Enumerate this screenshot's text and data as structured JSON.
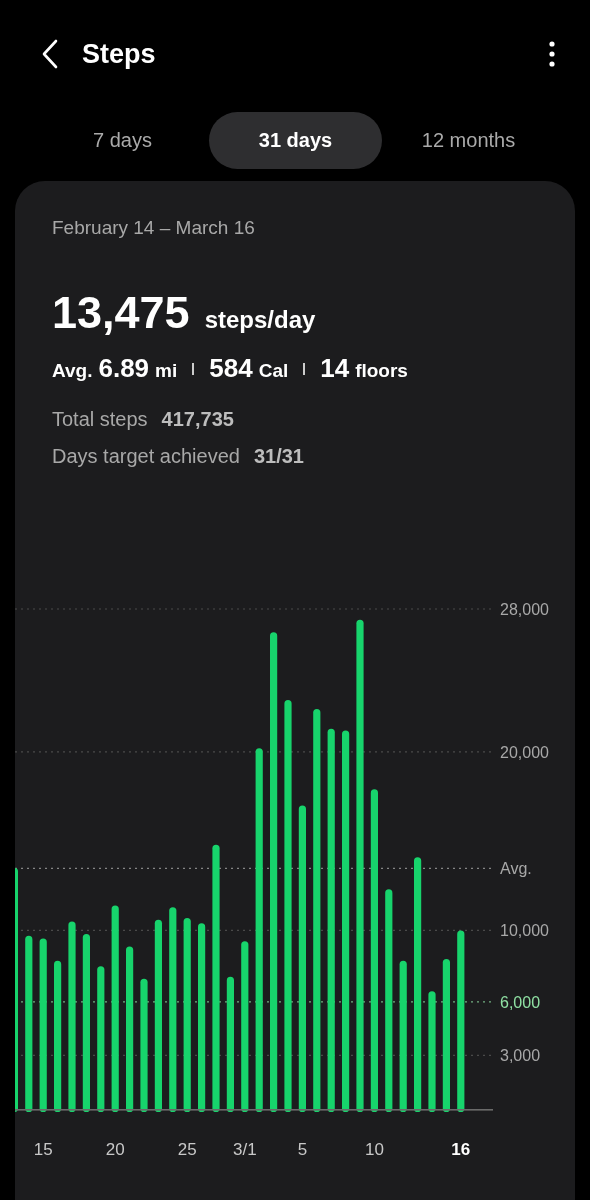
{
  "header": {
    "title": "Steps"
  },
  "tabs": [
    {
      "label": "7 days",
      "selected": false
    },
    {
      "label": "31 days",
      "selected": true
    },
    {
      "label": "12 months",
      "selected": false
    }
  ],
  "summary": {
    "date_range": "February 14 – March 16",
    "steps_per_day": {
      "value": "13,475",
      "unit": "steps/day"
    },
    "averages": {
      "label": "Avg.",
      "items": [
        {
          "value": "6.89",
          "unit": "mi"
        },
        {
          "value": "584",
          "unit": "Cal"
        },
        {
          "value": "14",
          "unit": "floors"
        }
      ]
    },
    "totals": [
      {
        "label": "Total steps",
        "value": "417,735"
      },
      {
        "label": "Days target achieved",
        "value": "31/31"
      }
    ]
  },
  "chart_data": {
    "type": "bar",
    "categories": [
      null,
      null,
      "15",
      null,
      null,
      null,
      null,
      "20",
      null,
      null,
      null,
      null,
      "25",
      null,
      null,
      null,
      "3/1",
      null,
      null,
      null,
      "5",
      null,
      null,
      null,
      null,
      "10",
      null,
      null,
      null,
      null,
      null,
      "16"
    ],
    "values": [
      13500,
      9700,
      9550,
      8300,
      10500,
      9800,
      8000,
      11400,
      9100,
      7300,
      10600,
      11300,
      10700,
      10400,
      14800,
      7400,
      9400,
      20200,
      26700,
      22900,
      17000,
      22400,
      21300,
      21200,
      27400,
      17900,
      12300,
      8300,
      14100,
      6600,
      8400,
      10000
    ],
    "ylim": [
      0,
      28000
    ],
    "grid": true,
    "yticks": [
      {
        "value": 28000,
        "label": "28,000"
      },
      {
        "value": 20000,
        "label": "20,000"
      },
      {
        "value": 10000,
        "label": "10,000"
      },
      {
        "value": 3000,
        "label": "3,000"
      }
    ],
    "ref_lines": [
      {
        "axis": "y",
        "value": 13475,
        "label": "Avg.",
        "color": "#a8a8a8"
      },
      {
        "axis": "y",
        "value": 6000,
        "label": "6,000",
        "color": "#8fe0a3"
      }
    ]
  }
}
